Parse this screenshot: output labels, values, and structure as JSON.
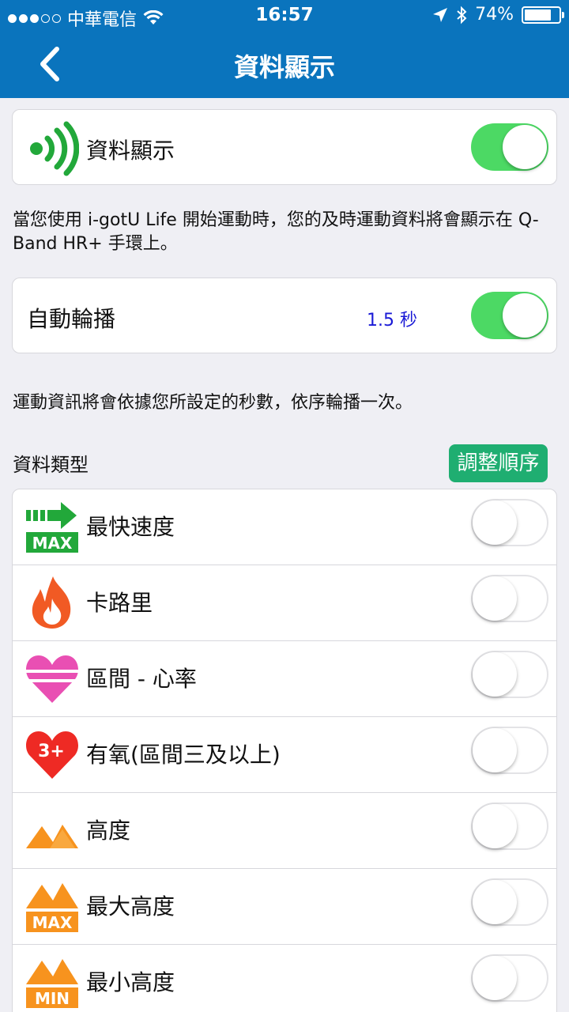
{
  "status_bar": {
    "carrier": "中華電信",
    "time": "16:57",
    "battery": "74%"
  },
  "nav": {
    "title": "資料顯示",
    "back_icon": "chevron-left-icon"
  },
  "data_display": {
    "label": "資料顯示",
    "icon": "wireless-signal-icon",
    "enabled": true,
    "description": "當您使用 i-gotU Life 開始運動時，您的及時運動資料將會顯示在 Q-Band HR+ 手環上。"
  },
  "auto_rotate": {
    "label": "自動輪播",
    "interval": "1.5 秒",
    "enabled": true,
    "description": "運動資訊將會依據您所設定的秒數，依序輪播一次。"
  },
  "data_types": {
    "section_title": "資料類型",
    "adjust_button": "調整順序",
    "items": [
      {
        "label": "最快速度",
        "icon": "max-speed-icon",
        "enabled": false
      },
      {
        "label": "卡路里",
        "icon": "calorie-flame-icon",
        "enabled": false
      },
      {
        "label": "區間 - 心率",
        "icon": "heart-rate-zone-icon",
        "enabled": false
      },
      {
        "label": "有氧(區間三及以上)",
        "icon": "aerobic-heart-icon",
        "enabled": false
      },
      {
        "label": "高度",
        "icon": "altitude-icon",
        "enabled": false
      },
      {
        "label": "最大高度",
        "icon": "max-altitude-icon",
        "enabled": false
      },
      {
        "label": "最小高度",
        "icon": "min-altitude-icon",
        "enabled": false
      }
    ],
    "icon_texts": {
      "max": "MAX",
      "min": "MIN",
      "three_plus": "3+"
    }
  },
  "colors": {
    "nav_blue": "#0a74bd",
    "toggle_green": "#4cd964",
    "button_green": "#1fae71",
    "link_blue": "#1a1ad6"
  }
}
